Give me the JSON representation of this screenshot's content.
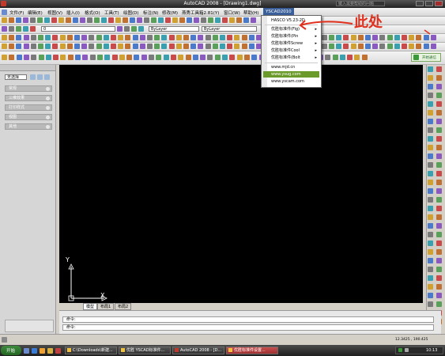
{
  "window": {
    "title": "AutoCAD 2008 - [Drawing1.dwg]",
    "search_placeholder": "键入需要帮助的问题"
  },
  "menubar": {
    "items": [
      "文件(F)",
      "编辑(E)",
      "视图(V)",
      "插入(I)",
      "格式(O)",
      "工具(T)",
      "绘图(D)",
      "标注(N)",
      "修改(M)",
      "燕秀工具箱2.81(Y)",
      "窗口(W)",
      "帮助(H)",
      "YSCAD2010"
    ]
  },
  "toolbar": {
    "layer_value": "0",
    "color_value": "ByLayer",
    "linetype_value": "ByLayer"
  },
  "dropdown": {
    "items": [
      {
        "label": "HASCO V5.23-2D",
        "arrow": ""
      },
      {
        "label": "优胜标准件(Fig)",
        "arrow": "▸"
      },
      {
        "label": "优胜标准件(Pin",
        "arrow": "▸"
      },
      {
        "label": "优胜标准件Screw",
        "arrow": "▸"
      },
      {
        "label": "优胜标准件Cool",
        "arrow": "▸"
      },
      {
        "label": "优胜标准件(Bolt",
        "arrow": "▸"
      },
      {
        "label": "www.mjd.cn",
        "arrow": ""
      },
      {
        "label": "www.ysug.com",
        "arrow": ""
      },
      {
        "label": "www.yscam.com",
        "arrow": ""
      }
    ]
  },
  "annotation": {
    "text": "此处",
    "color": "#e0301e"
  },
  "left_panel": {
    "select_value": "无选择",
    "items": [
      "常规",
      "三维效果",
      "打印样式",
      "视图",
      "其他"
    ]
  },
  "canvas": {
    "y_axis": "Y",
    "x_axis": "X"
  },
  "layout_tabs": [
    "模型",
    "布局1",
    "布局2"
  ],
  "command": {
    "line1": "命令:",
    "line2": "命令:"
  },
  "status": {
    "coords": "12.3425 , 190.425",
    "clock": "10:13"
  },
  "taskbar": {
    "start": "开始",
    "tasks": [
      "C:\\Downloads\\新建...",
      "优胜 YSCAD标准件...",
      "AutoCAD 2008 - [D...",
      "优胜标准件设置..."
    ]
  },
  "balloon": "开始通信"
}
